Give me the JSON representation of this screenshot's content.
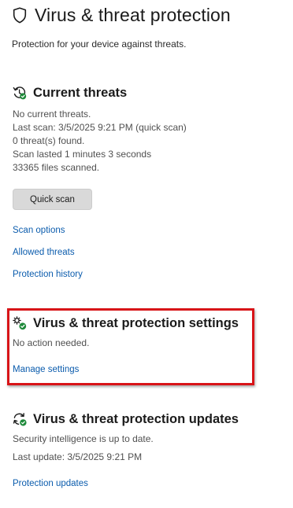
{
  "header": {
    "title": "Virus & threat protection",
    "subtitle": "Protection for your device against threats.",
    "icon": "shield-icon"
  },
  "current_threats": {
    "icon": "clock-refresh-icon",
    "title": "Current threats",
    "lines": [
      "No current threats.",
      "Last scan: 3/5/2025 9:21 PM (quick scan)",
      "0 threat(s) found.",
      "Scan lasted 1 minutes 3 seconds",
      "33365 files scanned."
    ],
    "quick_scan_label": "Quick scan",
    "links": {
      "scan_options": "Scan options",
      "allowed_threats": "Allowed threats",
      "protection_history": "Protection history"
    }
  },
  "settings": {
    "icon": "gears-check-icon",
    "title": "Virus & threat protection settings",
    "status": "No action needed.",
    "manage_link": "Manage settings",
    "highlight_color": "#d81418"
  },
  "updates": {
    "icon": "refresh-check-icon",
    "title": "Virus & threat protection updates",
    "lines": [
      "Security intelligence is up to date.",
      "Last update: 3/5/2025 9:21 PM"
    ],
    "link": "Protection updates"
  },
  "colors": {
    "link": "#0b5cad",
    "status_green": "#1f8a3b",
    "button_bg": "#d9d9d9"
  }
}
